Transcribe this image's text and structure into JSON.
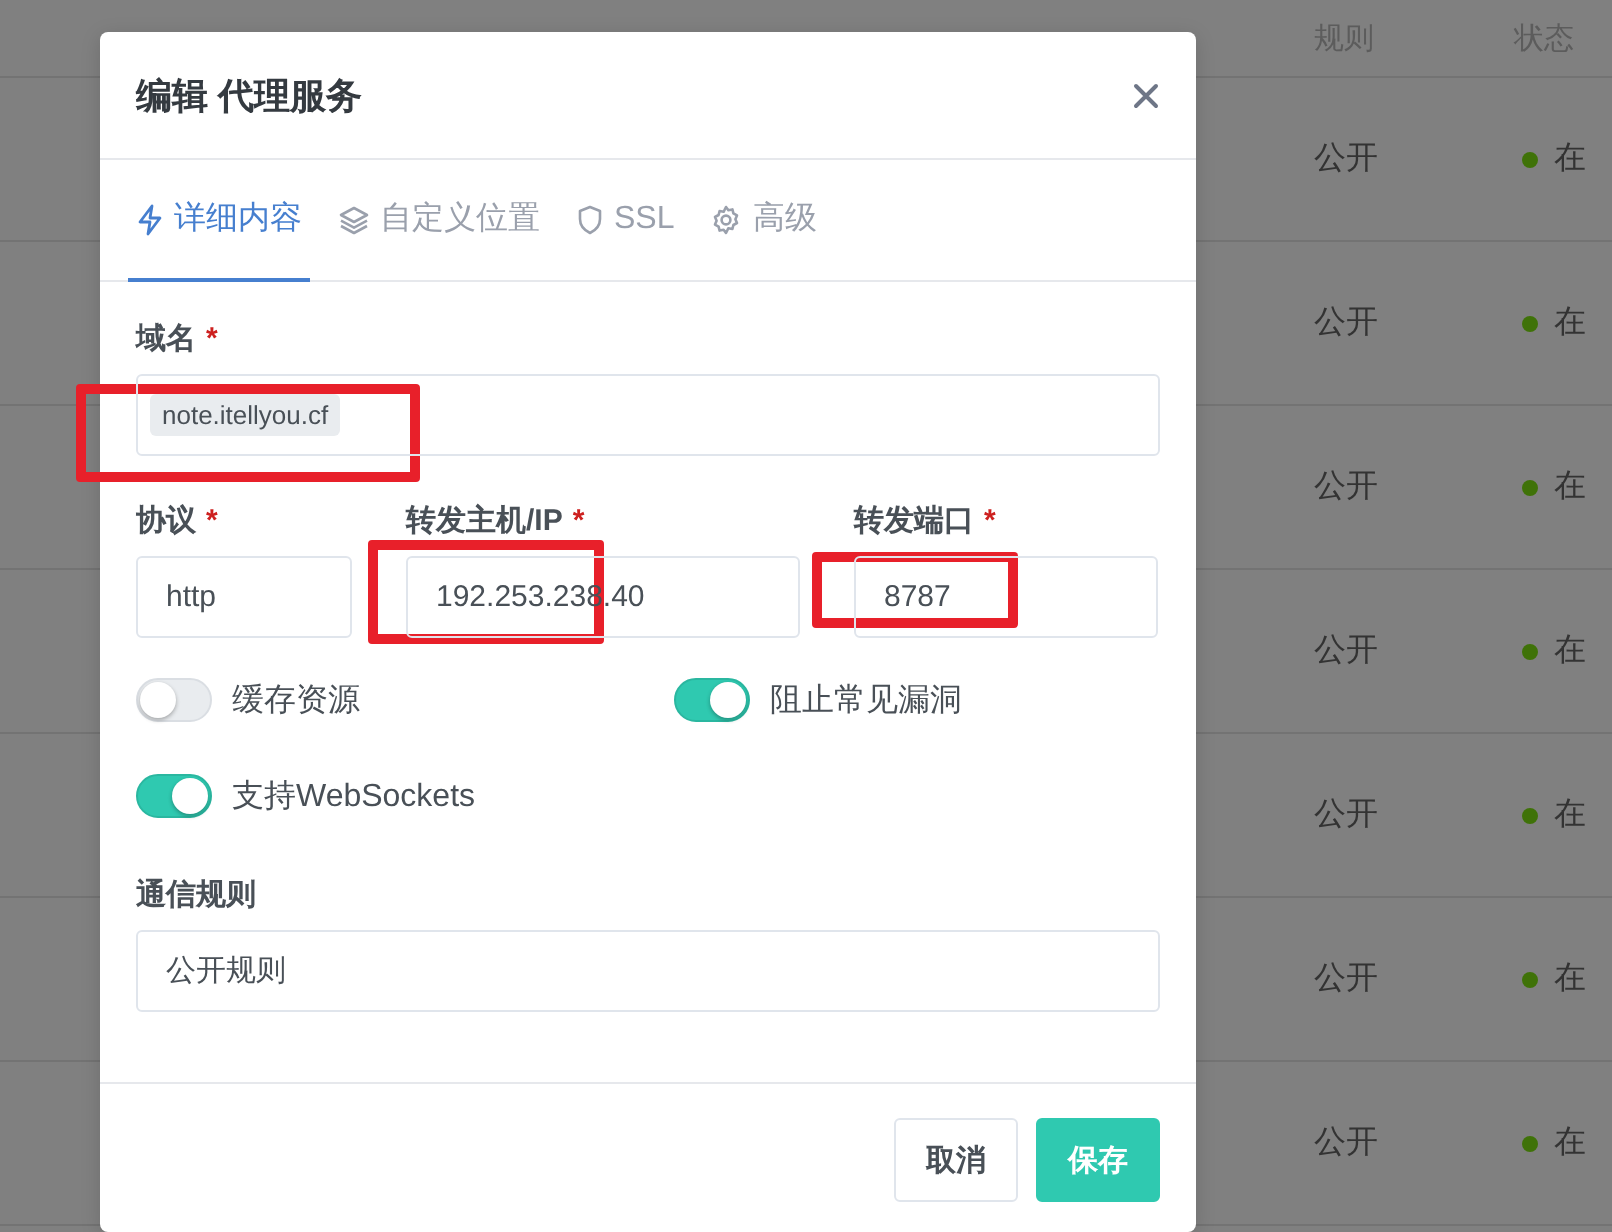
{
  "background_table": {
    "columns": [
      {
        "label": "规则"
      },
      {
        "label": "状态"
      }
    ],
    "rows": [
      {
        "rule": "公开",
        "status": "在",
        "color": "#3f7208"
      },
      {
        "rule": "公开",
        "status": "在",
        "color": "#3f7208"
      },
      {
        "rule": "公开",
        "status": "在",
        "color": "#3f7208"
      },
      {
        "rule": "公开",
        "status": "在",
        "color": "#3f7208"
      },
      {
        "rule": "公开",
        "status": "在",
        "color": "#3f7208"
      },
      {
        "rule": "公开",
        "status": "在",
        "color": "#3f7208"
      },
      {
        "rule": "公开",
        "status": "在",
        "color": "#3f7208"
      }
    ]
  },
  "dialog": {
    "title": "编辑 代理服务",
    "tabs": [
      {
        "label": "详细内容",
        "selected": true
      },
      {
        "label": "自定义位置",
        "selected": false
      },
      {
        "label": "SSL",
        "selected": false
      },
      {
        "label": "高级",
        "selected": false
      }
    ],
    "domain": {
      "label": "域名",
      "required_mark": "*",
      "tags": [
        "note.itellyou.cf"
      ],
      "highlighted": true
    },
    "protocol": {
      "label": "协议",
      "required_mark": "*",
      "value": "http"
    },
    "forward_host": {
      "label": "转发主机/IP",
      "required_mark": "*",
      "value": "192.253.238.40",
      "highlighted": true
    },
    "forward_port": {
      "label": "转发端口",
      "required_mark": "*",
      "value": "8787",
      "highlighted": true
    },
    "toggles": [
      {
        "label": "缓存资源",
        "on": false
      },
      {
        "label": "阻止常见漏洞",
        "on": true
      },
      {
        "label": "支持WebSockets",
        "on": true
      }
    ],
    "access_rule": {
      "label": "通信规则",
      "value": "公开规则"
    },
    "buttons": [
      {
        "label": "取消",
        "kind": "default"
      },
      {
        "label": "保存",
        "kind": "primary"
      }
    ]
  }
}
